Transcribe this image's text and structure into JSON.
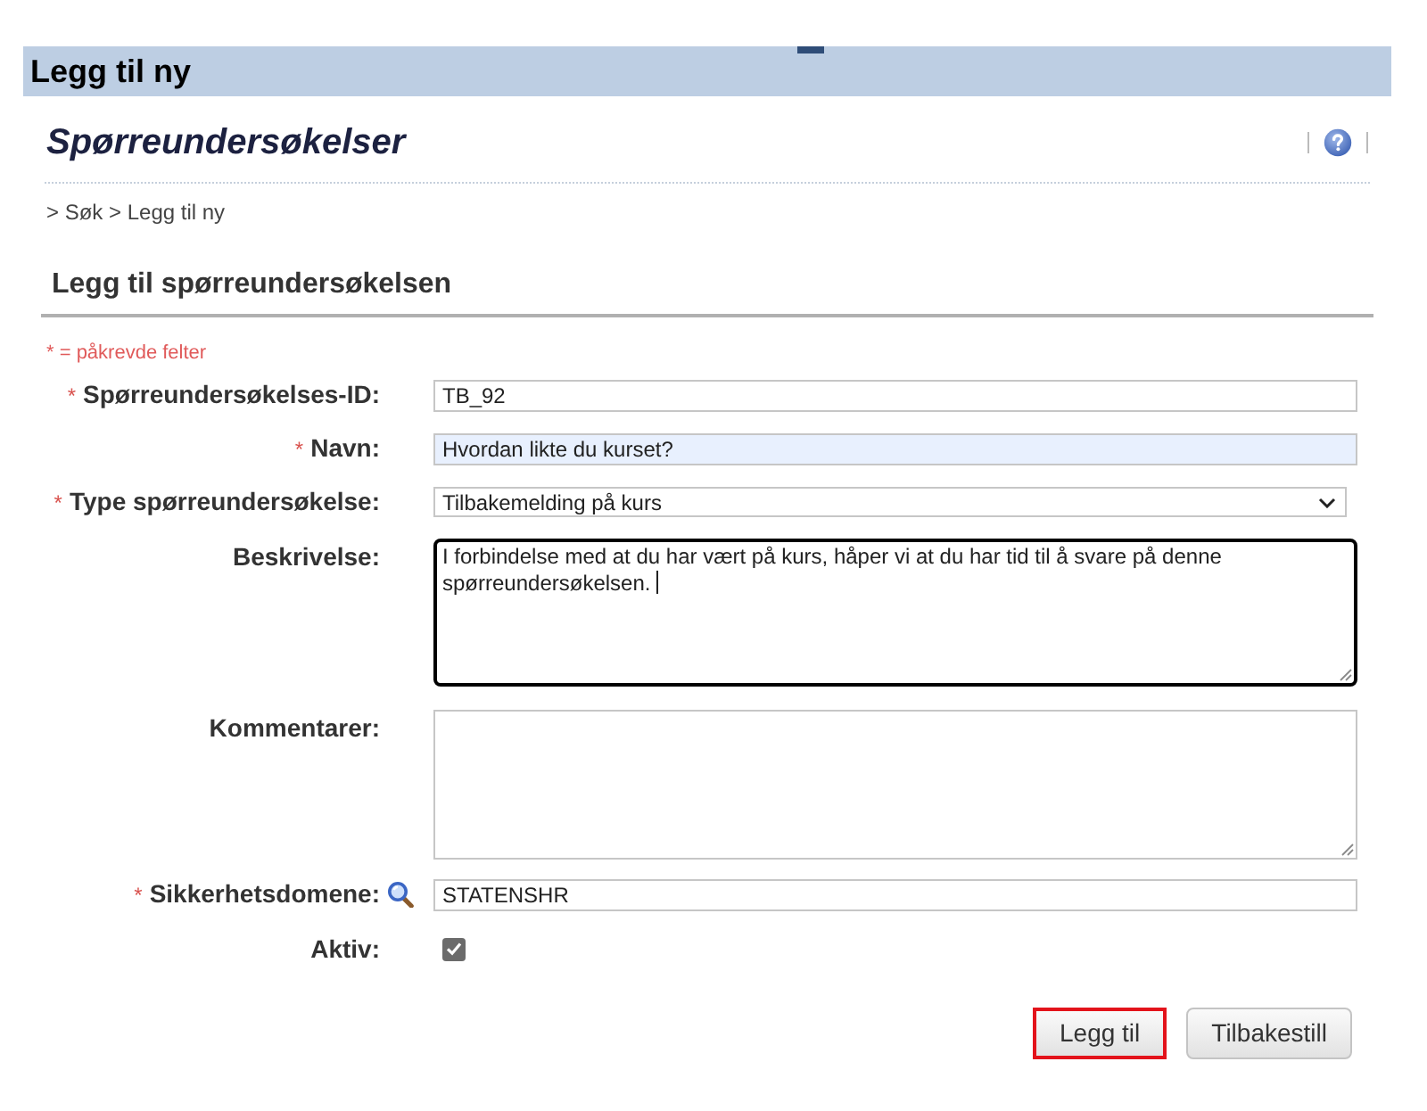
{
  "banner": {
    "title": "Legg til ny"
  },
  "page": {
    "title": "Spørreundersøkelser",
    "breadcrumb": "> Søk > Legg til ny"
  },
  "form": {
    "title": "Legg til spørreundersøkelsen",
    "required_note": "* = påkrevde felter",
    "required_marker": "*",
    "fields": [
      {
        "kind": "text",
        "label": "Spørreundersøkelses-ID:",
        "required": true,
        "value": "TB_92",
        "highlighted": false
      },
      {
        "kind": "text",
        "label": "Navn:",
        "required": true,
        "value": "Hvordan likte du kurset?",
        "highlighted": true
      },
      {
        "kind": "select",
        "label": "Type spørreundersøkelse:",
        "required": true,
        "value": "Tilbakemelding på kurs"
      },
      {
        "kind": "textarea",
        "label": "Beskrivelse:",
        "required": false,
        "value": "I forbindelse med at du har vært på kurs, håper vi at du har tid til å svare på denne spørreundersøkelsen.",
        "focused": true
      },
      {
        "kind": "textarea",
        "label": "Kommentarer:",
        "required": false,
        "focused": false
      },
      {
        "kind": "lookup",
        "label": "Sikkerhetsdomene:",
        "required": true,
        "value": "STATENSHR"
      },
      {
        "kind": "checkbox",
        "label": "Aktiv:",
        "required": false,
        "checked": true
      }
    ]
  },
  "buttons": [
    {
      "label": "Legg til",
      "highlighted": true
    },
    {
      "label": "Tilbakestill",
      "highlighted": false
    }
  ]
}
